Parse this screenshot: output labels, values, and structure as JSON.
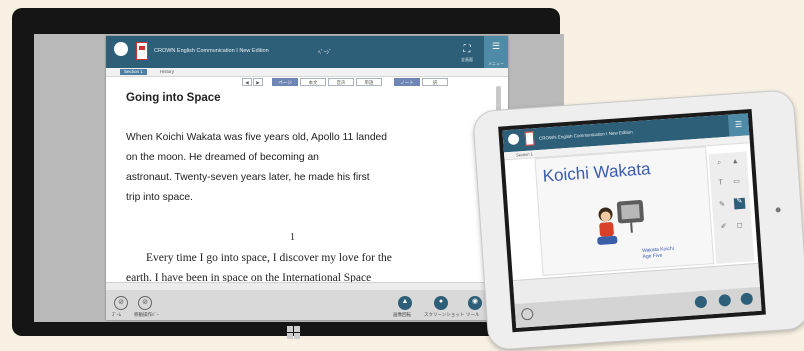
{
  "app": {
    "header_title": "CROWN English Communication Ⅰ New Edition",
    "header_title_suffix": "ﾍﾟｰｼﾞ",
    "fullscreen_label": "全画面",
    "menu_label": "メニュー",
    "tabs": [
      "Section 1",
      "History"
    ],
    "toolbar": [
      "◀",
      "▶",
      "ページ",
      "本文",
      "音声",
      "単語",
      "ノート",
      "訳"
    ]
  },
  "document": {
    "title": "Going into Space",
    "paragraph_lines": [
      "When Koichi Wakata was five years old, Apollo 11 landed",
      "on the moon.    He dreamed of becoming an",
      "astronaut.    Twenty-seven years later, he made his first",
      "trip into space."
    ],
    "section_number": "1",
    "section_lines": [
      "Every time I go into space, I discover my love for the",
      "earth.    I have been in space on the International Space"
    ]
  },
  "footer": {
    "left_buttons": [
      "ｽﾞｰﾑ",
      "移動操作ﾊﾞｰ"
    ],
    "right_buttons": [
      "画像回転",
      "スクリーンショット",
      "ツール"
    ]
  },
  "tablet": {
    "title": "Koichi Wakata",
    "caption": "Wakata Koichi Age Five",
    "tab_label": "Section 1"
  },
  "colors": {
    "header": "#2e5f78",
    "menu": "#4f8ba6",
    "accent_text": "#3a5bb0",
    "active_tab": "#4e7fa3"
  }
}
